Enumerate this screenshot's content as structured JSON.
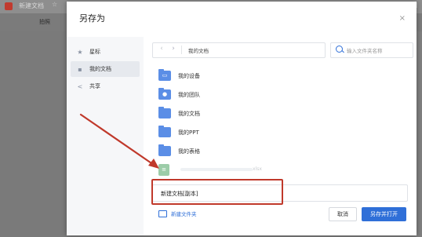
{
  "background": {
    "tab_title": "新建文档",
    "tab_star": "☆",
    "toolbar_item": "拍照"
  },
  "dialog": {
    "title": "另存为",
    "close_glyph": "×",
    "sidebar": {
      "items": [
        {
          "label": "星标",
          "icon": "star-icon"
        },
        {
          "label": "我的文档",
          "icon": "document-icon",
          "active": true
        },
        {
          "label": "共享",
          "icon": "share-icon"
        }
      ]
    },
    "nav": {
      "back_glyph": "‹",
      "forward_glyph": "›",
      "path": "我的文档"
    },
    "search": {
      "placeholder": "输入文件夹名称"
    },
    "files": [
      {
        "label": "我的设备",
        "icon": "device-folder-icon"
      },
      {
        "label": "我的团队",
        "icon": "team-folder-icon"
      },
      {
        "label": "我的文档",
        "icon": "folder-icon"
      },
      {
        "label": "我的PPT",
        "icon": "folder-icon"
      },
      {
        "label": "我的表格",
        "icon": "folder-icon"
      }
    ],
    "spreadsheet_file": {
      "name": "xlsx",
      "icon": "spreadsheet-file-icon"
    },
    "filename_input": {
      "value": "新建文档[副本]"
    },
    "new_folder_label": "新建文件夹",
    "cancel_label": "取消",
    "save_open_label": "另存并打开"
  },
  "colors": {
    "accent": "#2f6fd8",
    "annotation_red": "#c0392b",
    "folder_blue": "#5b8ee6"
  }
}
